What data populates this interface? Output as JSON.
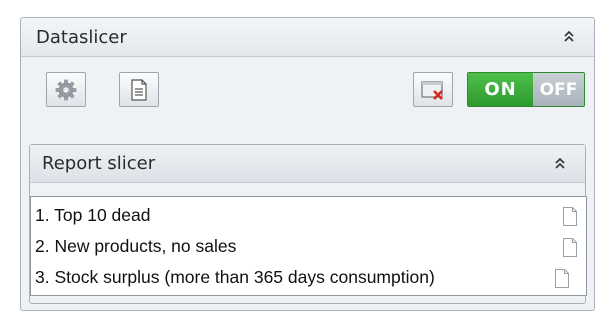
{
  "dataslicer": {
    "title": "Dataslicer",
    "toggle": {
      "on_label": "ON",
      "off_label": "OFF",
      "state": "on"
    }
  },
  "report_slicer": {
    "title": "Report slicer",
    "items": [
      {
        "label": "1. Top 10 dead"
      },
      {
        "label": "2. New products, no sales"
      },
      {
        "label": "3. Stock surplus (more than 365 days consumption)"
      }
    ]
  },
  "colors": {
    "toggle_on": "#3aaa37",
    "toggle_off": "#b7bfc6",
    "clear_icon_x": "#d9271c"
  },
  "icons": [
    "double-chevron-up-icon",
    "gear-icon",
    "document-icon",
    "clear-filter-icon"
  ]
}
